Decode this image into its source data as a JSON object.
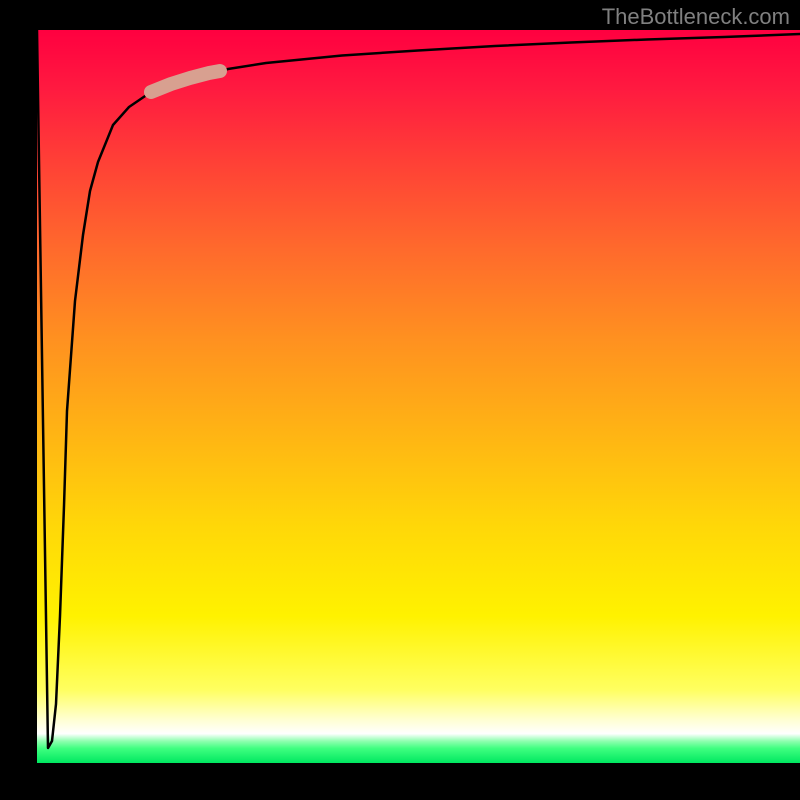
{
  "watermark": "TheBottleneck.com",
  "chart_data": {
    "type": "line",
    "title": "",
    "xlabel": "",
    "ylabel": "",
    "xlim": [
      0,
      100
    ],
    "ylim": [
      0,
      100
    ],
    "x": [
      0.0,
      1.5,
      2.0,
      2.5,
      3.0,
      3.5,
      4.0,
      5.0,
      6.0,
      7.0,
      8.0,
      10.0,
      12.0,
      15.0,
      20.0,
      25.0,
      30.0,
      40.0,
      50.0,
      60.0,
      70.0,
      80.0,
      90.0,
      100.0
    ],
    "values": [
      100.0,
      2.0,
      3.0,
      8.0,
      20.0,
      35.0,
      48.0,
      63.0,
      72.0,
      78.0,
      82.0,
      87.0,
      89.5,
      91.5,
      93.5,
      94.7,
      95.5,
      96.5,
      97.2,
      97.8,
      98.3,
      98.7,
      99.0,
      99.5
    ],
    "highlight_segment": {
      "x_start": 15.0,
      "x_end": 24.0,
      "y_start": 91.5,
      "y_end": 94.5,
      "color": "#d8a090"
    },
    "background_gradient": {
      "top": "red",
      "mid": "orange-yellow",
      "bottom": "green",
      "meaning": "severity scale (top high, bottom low)"
    },
    "grid": false,
    "legend": false
  }
}
